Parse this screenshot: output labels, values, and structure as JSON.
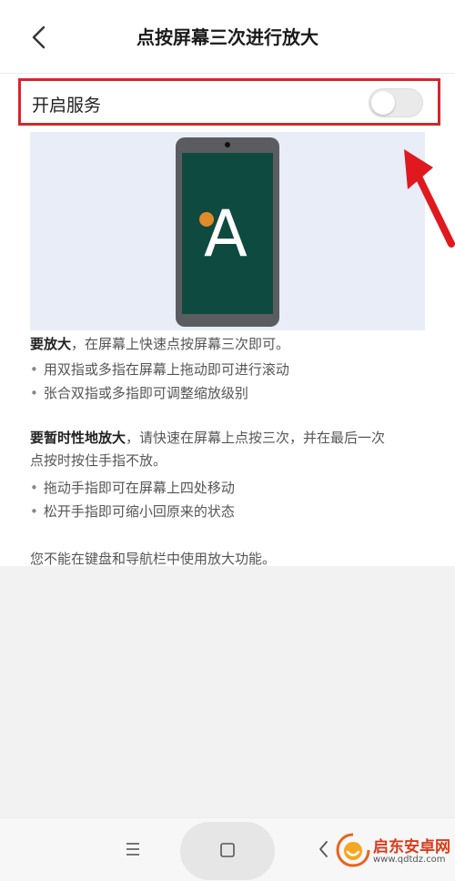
{
  "header": {
    "title": "点按屏幕三次进行放大"
  },
  "service": {
    "label": "开启服务",
    "enabled": false
  },
  "illustration": {
    "letter": "A"
  },
  "instructions": {
    "zoom_title": "要放大",
    "zoom_text": "，在屏幕上快速点按屏幕三次即可。",
    "zoom_bullets": [
      "用双指或多指在屏幕上拖动即可进行滚动",
      "张合双指或多指即可调整缩放级别"
    ],
    "temp_title": "要暂时性地放大",
    "temp_text_line1": "，请快速在屏幕上点按三次，并在最后一次",
    "temp_text_line2": "点按时按住手指不放。",
    "temp_bullets": [
      "拖动手指即可在屏幕上四处移动",
      "松开手指即可缩小回原来的状态"
    ],
    "note": "您不能在键盘和导航栏中使用放大功能。"
  },
  "annotation": {
    "highlight_color": "#d7262b"
  },
  "watermark": {
    "name": "启东安卓网",
    "url": "www.qdtdz.com"
  },
  "icons": {
    "back": "chevron-left-icon",
    "menu": "menu-icon",
    "home": "square-icon",
    "nav_back": "back-icon"
  }
}
